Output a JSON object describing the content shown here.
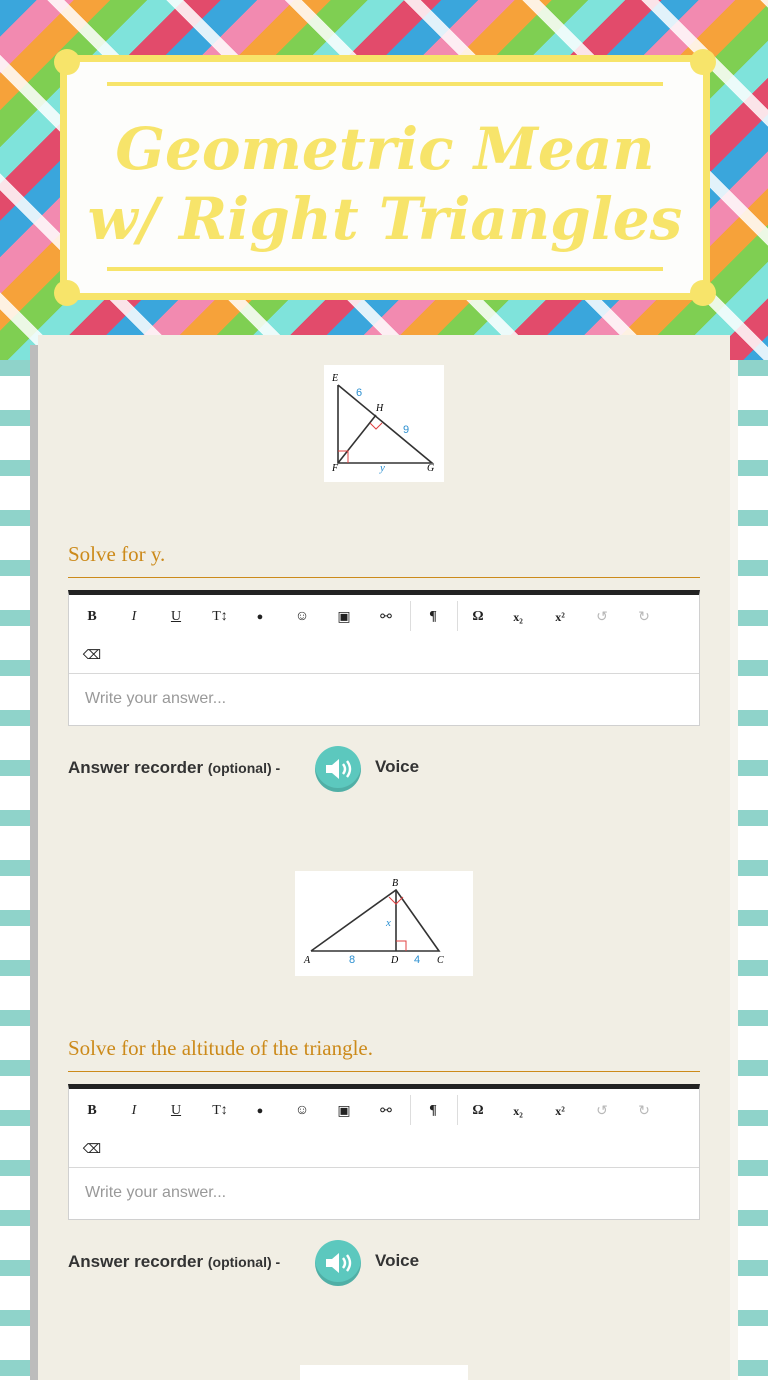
{
  "header": {
    "title": "Geometric Mean w/ Right Triangles"
  },
  "questions": [
    {
      "prompt": "Solve for y.",
      "figure": {
        "labels": [
          "E",
          "6",
          "H",
          "9",
          "F",
          "y",
          "G"
        ]
      },
      "editor": {
        "placeholder": "Write your answer..."
      },
      "recorder": {
        "label": "Answer recorder",
        "optional": "(optional) -",
        "voice": "Voice"
      }
    },
    {
      "prompt": "Solve for  the altitude of the triangle.",
      "figure": {
        "labels": [
          "B",
          "x",
          "A",
          "8",
          "D",
          "4",
          "C"
        ]
      },
      "editor": {
        "placeholder": "Write your answer..."
      },
      "recorder": {
        "label": "Answer recorder",
        "optional": "(optional) -",
        "voice": "Voice"
      }
    }
  ],
  "toolbar": {
    "bold": "B",
    "italic": "I",
    "underline": "U",
    "text_size": "T↕",
    "color": "●",
    "emoji": "☺",
    "image": "▣",
    "link": "⚯",
    "paragraph": "¶",
    "omega": "Ω",
    "subscript": "x₂",
    "superscript": "x²",
    "undo": "↺",
    "redo": "↻",
    "eraser": "⌫"
  },
  "colors": {
    "accent": "#cc8a1a",
    "title": "#f7e46a",
    "mic": "#5cc8be"
  }
}
